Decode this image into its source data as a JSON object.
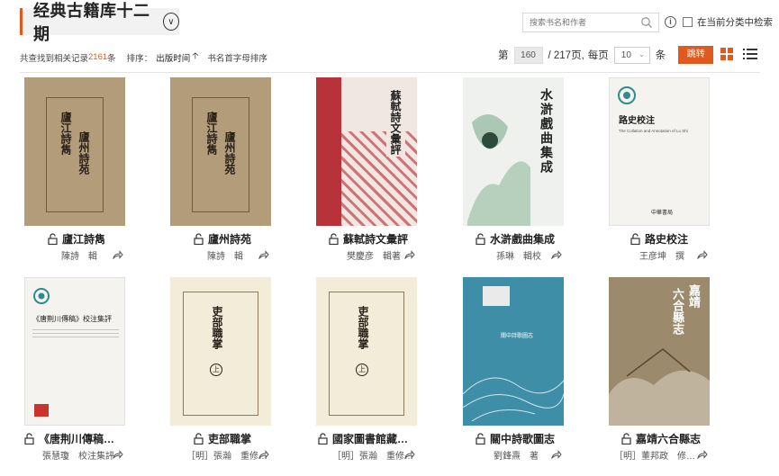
{
  "header": {
    "title": "经典古籍库十二期",
    "search_placeholder": "搜索书名和作者",
    "checkbox_label": "在当前分类中检索"
  },
  "results": {
    "prefix": "共查找到相关记录",
    "count": "2161",
    "suffix": "条",
    "sort_label": "排序：",
    "sort_active": "出版时间",
    "sort_alt": "书名首字母排序"
  },
  "pager": {
    "page_prefix": "第",
    "current_page": "160",
    "total": "/ 217页,",
    "per_page_label": "每页",
    "per_page_value": "10",
    "per_page_suffix": "条",
    "jump_label": "跳转"
  },
  "books": [
    {
      "title": "廬江詩雋",
      "author": "陳詩　輯",
      "cover_style": "brown",
      "cover_text": [
        "廬江詩雋",
        "廬州詩苑"
      ]
    },
    {
      "title": "廬州詩苑",
      "author": "陳詩　輯",
      "cover_style": "brown",
      "cover_text": [
        "廬江詩雋",
        "廬州詩苑"
      ]
    },
    {
      "title": "蘇軾詩文彙評",
      "author": "樊慶彦　輯著",
      "cover_style": "red",
      "cover_text": [
        "蘇軾詩文彙評"
      ]
    },
    {
      "title": "水滸戲曲集成",
      "author": "孫琳　輯校",
      "cover_style": "green",
      "cover_text": [
        "水滸戲曲集成"
      ]
    },
    {
      "title": "路史校注",
      "author": "王彦坤　撰",
      "cover_style": "white",
      "cover_text": [
        "路史校注",
        "The Collation and Annotation of Lu Shi",
        "中華書局"
      ]
    },
    {
      "title": "《唐荆川傳稿…",
      "author": "張慧瓊　校注集評",
      "cover_style": "white",
      "cover_text": [
        "《唐荆川傳稿》校注集評"
      ]
    },
    {
      "title": "吏部職掌",
      "author": "［明］張瀚　重修…",
      "cover_style": "cream",
      "cover_text": [
        "吏部職掌",
        "上"
      ]
    },
    {
      "title": "國家圖書館藏…",
      "author": "［明］張瀚　重修…",
      "cover_style": "cream",
      "cover_text": [
        "吏部職掌",
        "上"
      ]
    },
    {
      "title": "關中詩歌圖志",
      "author": "劉鋒燾　著",
      "cover_style": "teal",
      "cover_text": [
        "關中詩歌圖志"
      ]
    },
    {
      "title": "嘉靖六合縣志",
      "author": "［明］董邦政　修…",
      "cover_style": "sepia",
      "cover_text": [
        "嘉靖",
        "六合縣志"
      ]
    }
  ],
  "colors": {
    "accent": "#e05a1f"
  }
}
